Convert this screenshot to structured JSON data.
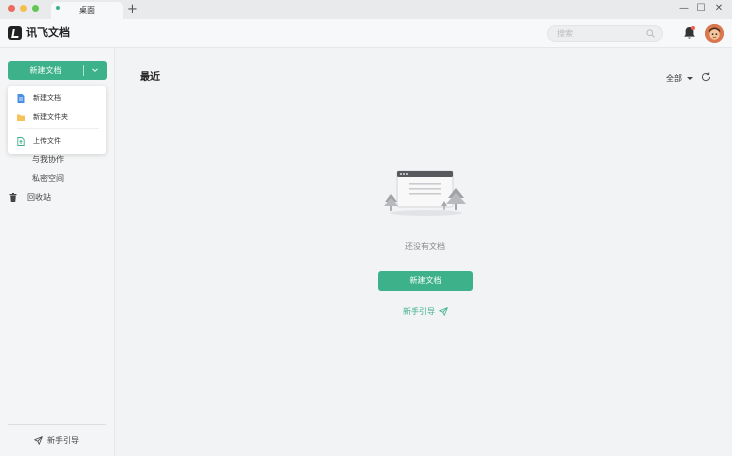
{
  "tab": {
    "title": "桌面",
    "add": "+"
  },
  "window_controls": {
    "minimize": "—",
    "maximize": "☐",
    "close": "✕"
  },
  "app": {
    "name": "讯飞文档"
  },
  "search": {
    "placeholder": "搜索"
  },
  "sidebar": {
    "new_button": "新建文档",
    "items": [
      {
        "label": "与我协作"
      },
      {
        "label": "私密空间"
      },
      {
        "label": "回收站",
        "icon": "trash-icon"
      }
    ],
    "guide": "新手引导"
  },
  "dropdown": {
    "items": [
      {
        "label": "新建文档",
        "icon": "document-icon"
      },
      {
        "label": "新建文件夹",
        "icon": "folder-icon"
      },
      {
        "label": "上传文件",
        "icon": "upload-icon"
      }
    ]
  },
  "main": {
    "title": "最近",
    "filter": "全部",
    "empty_text": "还没有文档",
    "create_button": "新建文档",
    "guide_link": "新手引导"
  },
  "colors": {
    "accent": "#3cb18a",
    "background": "#f2f3f5"
  }
}
